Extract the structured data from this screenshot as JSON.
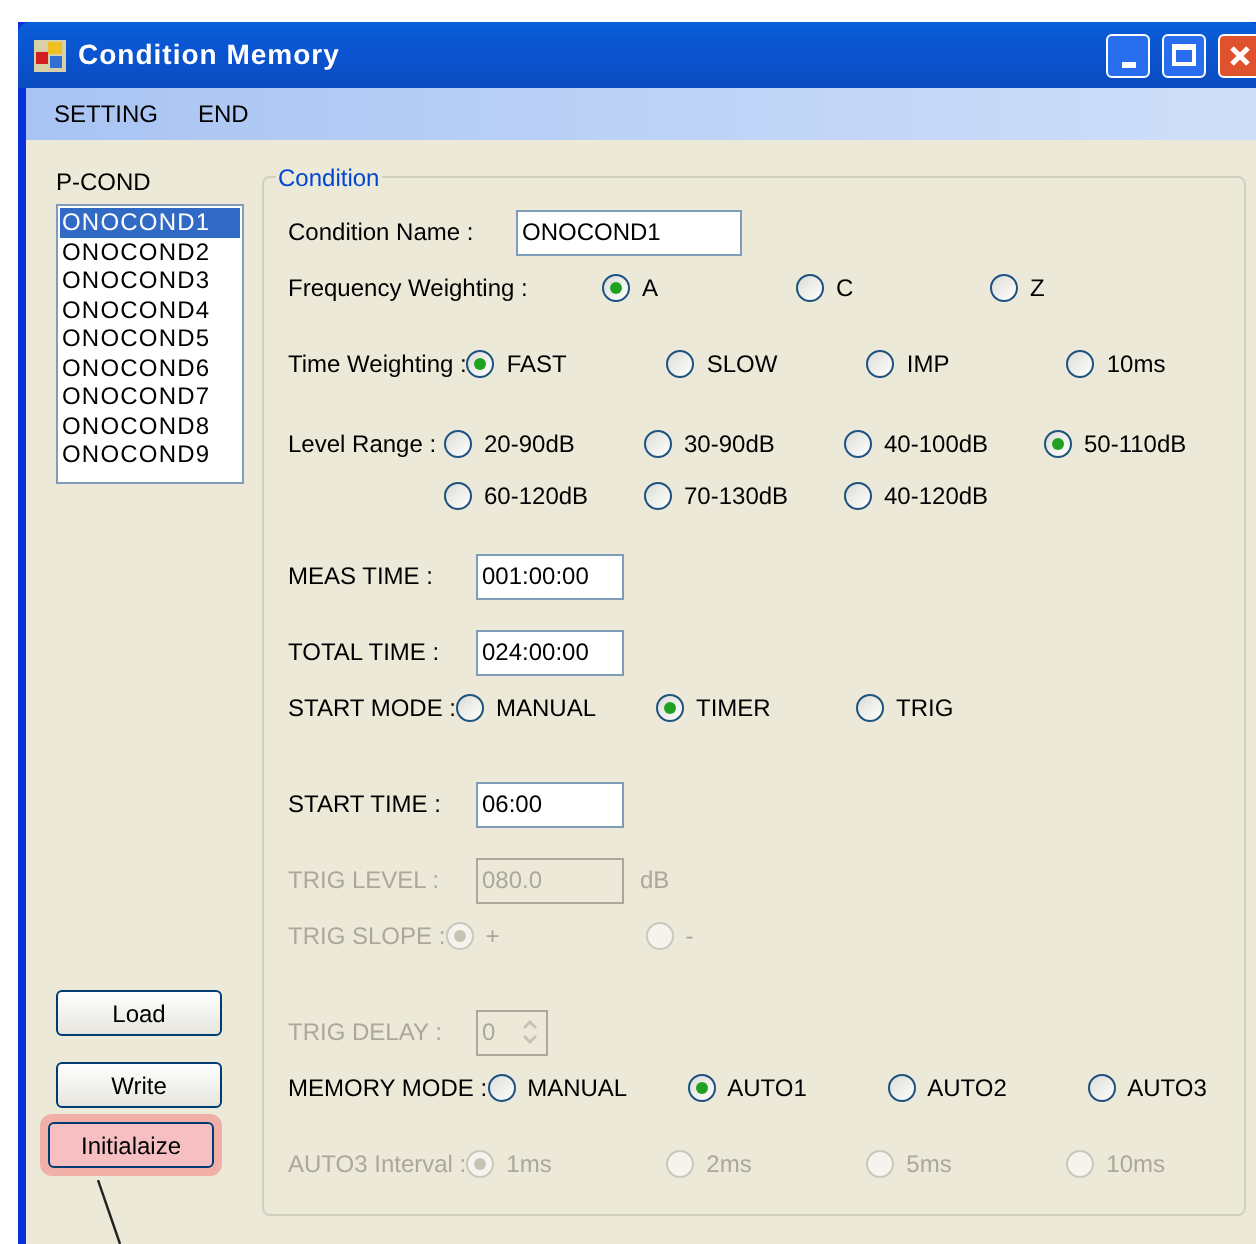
{
  "window": {
    "title": "Condition Memory"
  },
  "menu": [
    "SETTING",
    "END"
  ],
  "pcond": {
    "label": "P-COND",
    "items": [
      {
        "text": "ONOCOND1",
        "selected": true
      },
      {
        "text": "ONOCOND2",
        "selected": false
      },
      {
        "text": "ONOCOND3",
        "selected": false
      },
      {
        "text": "ONOCOND4",
        "selected": false
      },
      {
        "text": "ONOCOND5",
        "selected": false
      },
      {
        "text": "ONOCOND6",
        "selected": false
      },
      {
        "text": "ONOCOND7",
        "selected": false
      },
      {
        "text": "ONOCOND8",
        "selected": false
      },
      {
        "text": "ONOCOND9",
        "selected": false
      }
    ]
  },
  "buttons": [
    {
      "label": "Load",
      "highlighted": false
    },
    {
      "label": "Write",
      "highlighted": false
    },
    {
      "label": "Initialaize",
      "highlighted": true
    }
  ],
  "condition": {
    "title": "Condition",
    "rows": [
      {
        "kind": "name",
        "label": "Condition Name :",
        "value": "ONOCOND1",
        "disabled": false
      },
      {
        "kind": "radio",
        "label": "Frequency Weighting :",
        "disabled": false,
        "options": [
          {
            "label": "A",
            "selected": true
          },
          {
            "label": "C",
            "selected": false
          },
          {
            "label": "Z",
            "selected": false
          }
        ]
      },
      {
        "kind": "radio",
        "label": "Time Weighting :",
        "disabled": false,
        "options": [
          {
            "label": "FAST",
            "selected": true
          },
          {
            "label": "SLOW",
            "selected": false
          },
          {
            "label": "IMP",
            "selected": false
          },
          {
            "label": "10ms",
            "selected": false
          }
        ]
      },
      {
        "kind": "radio",
        "label": "Level Range :",
        "disabled": false,
        "options": [
          {
            "label": "20-90dB",
            "selected": false
          },
          {
            "label": "30-90dB",
            "selected": false
          },
          {
            "label": "40-100dB",
            "selected": false
          },
          {
            "label": "50-110dB",
            "selected": true
          },
          {
            "label": "60-120dB",
            "selected": false
          },
          {
            "label": "70-130dB",
            "selected": false
          },
          {
            "label": "40-120dB",
            "selected": false
          }
        ]
      },
      {
        "kind": "field",
        "label": "MEAS TIME :",
        "value": "001:00:00",
        "disabled": false
      },
      {
        "kind": "field",
        "label": "TOTAL TIME :",
        "value": "024:00:00",
        "disabled": false
      },
      {
        "kind": "radio",
        "label": "START MODE :",
        "disabled": false,
        "options": [
          {
            "label": "MANUAL",
            "selected": false
          },
          {
            "label": "TIMER",
            "selected": true
          },
          {
            "label": "TRIG",
            "selected": false
          }
        ]
      },
      {
        "kind": "field",
        "label": "START TIME :",
        "value": "06:00",
        "disabled": false
      },
      {
        "kind": "field",
        "label": "TRIG LEVEL :",
        "value": "080.0",
        "unit": "dB",
        "disabled": true
      },
      {
        "kind": "radio",
        "label": "TRIG SLOPE :",
        "disabled": true,
        "options": [
          {
            "label": "+",
            "selected": true
          },
          {
            "label": "-",
            "selected": false
          }
        ]
      },
      {
        "kind": "spin",
        "label": "TRIG DELAY :",
        "value": "0",
        "disabled": true
      },
      {
        "kind": "radio",
        "label": "MEMORY MODE :",
        "disabled": false,
        "options": [
          {
            "label": "MANUAL",
            "selected": false
          },
          {
            "label": "AUTO1",
            "selected": true
          },
          {
            "label": "AUTO2",
            "selected": false
          },
          {
            "label": "AUTO3",
            "selected": false
          }
        ]
      },
      {
        "kind": "radio",
        "label": "AUTO3 Interval :",
        "disabled": true,
        "options": [
          {
            "label": "1ms",
            "selected": true
          },
          {
            "label": "2ms",
            "selected": false
          },
          {
            "label": "5ms",
            "selected": false
          },
          {
            "label": "10ms",
            "selected": false
          }
        ]
      }
    ]
  }
}
